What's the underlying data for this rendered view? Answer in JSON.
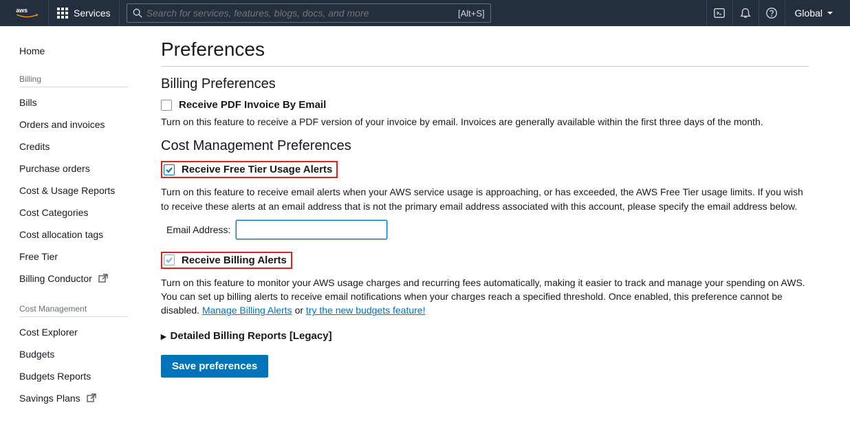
{
  "header": {
    "services_label": "Services",
    "search_placeholder": "Search for services, features, blogs, docs, and more",
    "search_shortcut": "[Alt+S]",
    "region": "Global"
  },
  "sidebar": {
    "home": "Home",
    "section_billing": "Billing",
    "items_billing": [
      "Bills",
      "Orders and invoices",
      "Credits",
      "Purchase orders",
      "Cost & Usage Reports",
      "Cost Categories",
      "Cost allocation tags",
      "Free Tier"
    ],
    "billing_conductor": "Billing Conductor",
    "section_costmgmt": "Cost Management",
    "items_costmgmt": [
      "Cost Explorer",
      "Budgets",
      "Budgets Reports"
    ],
    "savings_plans": "Savings Plans"
  },
  "main": {
    "page_title": "Preferences",
    "billing_prefs": "Billing Preferences",
    "pdf_label": "Receive PDF Invoice By Email",
    "pdf_desc": "Turn on this feature to receive a PDF version of your invoice by email. Invoices are generally available within the first three days of the month.",
    "cost_mgmt_prefs": "Cost Management Preferences",
    "freetier_label": "Receive Free Tier Usage Alerts",
    "freetier_desc": "Turn on this feature to receive email alerts when your AWS service usage is approaching, or has exceeded, the AWS Free Tier usage limits. If you wish to receive these alerts at an email address that is not the primary email address associated with this account, please specify the email address below.",
    "email_label": "Email Address:",
    "billing_alerts_label": "Receive Billing Alerts",
    "billing_alerts_desc_pre": "Turn on this feature to monitor your AWS usage charges and recurring fees automatically, making it easier to track and manage your spending on AWS. You can set up billing alerts to receive email notifications when your charges reach a specified threshold. Once enabled, this preference cannot be disabled. ",
    "link_manage": "Manage Billing Alerts",
    "or_text": " or ",
    "link_budgets": "try the new budgets feature!",
    "detailed_reports": "Detailed Billing Reports [Legacy]",
    "save_btn": "Save preferences"
  }
}
